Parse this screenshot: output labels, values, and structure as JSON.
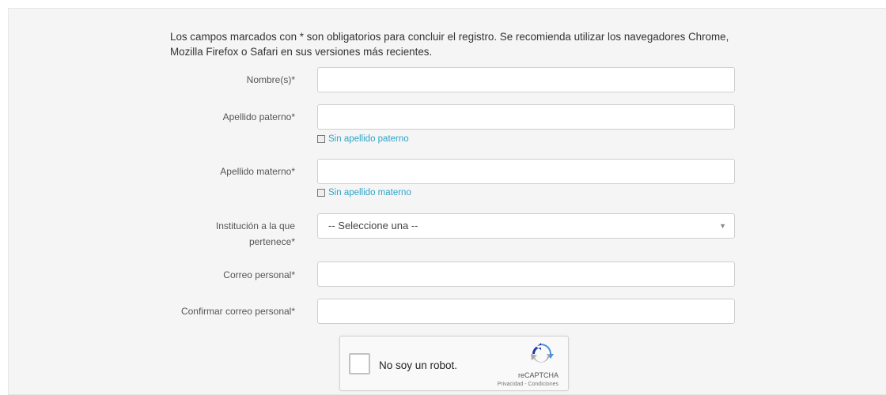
{
  "intro_text": "Los campos marcados con * son obligatorios para concluir el registro. Se recomienda utilizar los navegadores Chrome, Mozilla Firefox o Safari en sus versiones más recientes.",
  "fields": {
    "nombre_label": "Nombre(s)*",
    "paterno_label": "Apellido paterno*",
    "sin_paterno": "Sin apellido paterno",
    "materno_label": "Apellido materno*",
    "sin_materno": "Sin apellido materno",
    "institucion_label_1": "Institución a la que",
    "institucion_label_2": "pertenece*",
    "institucion_selected": "-- Seleccione una --",
    "correo_label": "Correo personal*",
    "confirmar_label": "Confirmar correo personal*"
  },
  "captcha": {
    "label": "No soy un robot.",
    "brand": "reCAPTCHA",
    "terms": "Privacidad - Condiciones"
  },
  "icons": {
    "select_caret": "chevron-down-icon",
    "captcha_logo": "recaptcha-icon"
  },
  "colors": {
    "link": "#2fa4c7",
    "panel_bg": "#f5f5f5"
  }
}
